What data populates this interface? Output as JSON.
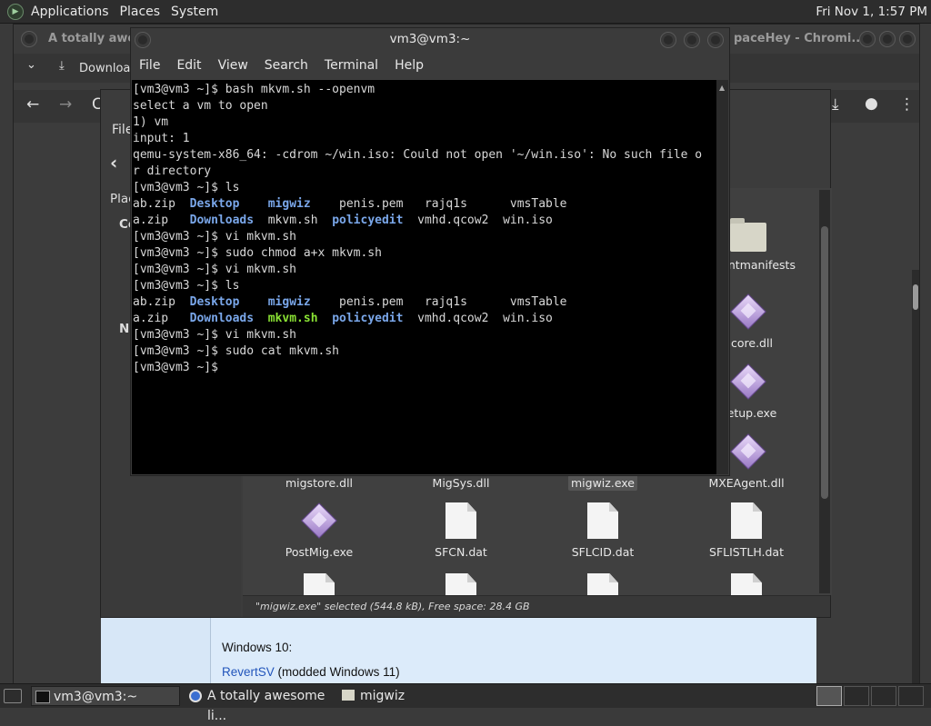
{
  "top_panel": {
    "menus": [
      "Applications",
      "Places",
      "System"
    ],
    "clock": "Fri Nov 1,  1:57 PM"
  },
  "chromium": {
    "title_left": "A totally awesome",
    "title_right": "paceHey - Chromi...",
    "download_label": "Download",
    "web_line1": "Windows 10:",
    "web_link": "RevertSV",
    "web_link_after": " (modded Windows 11)"
  },
  "file_manager": {
    "menu_partial": "File",
    "sidebar_partial": [
      "Plac",
      "Co",
      "N"
    ],
    "row1": [
      {
        "name": "mentmanifests",
        "kind": "folder"
      },
      {
        "name": "gcore.dll",
        "kind": "exe"
      },
      {
        "name": "Setup.exe",
        "kind": "exe"
      },
      {
        "name": "",
        "kind": "exe"
      }
    ],
    "row_labels": [
      "migstore.dll",
      "MigSys.dll",
      "migwiz.exe",
      "MXEAgent.dll"
    ],
    "row2": [
      {
        "name": "PostMig.exe",
        "kind": "exe"
      },
      {
        "name": "SFCN.dat",
        "kind": "doc"
      },
      {
        "name": "SFLCID.dat",
        "kind": "doc"
      },
      {
        "name": "SFLISTLH.dat",
        "kind": "doc"
      }
    ],
    "status": "\"migwiz.exe\" selected (544.8 kB), Free space: 28.4 GB"
  },
  "terminal": {
    "title": "vm3@vm3:~",
    "menus": [
      "File",
      "Edit",
      "View",
      "Search",
      "Terminal",
      "Help"
    ],
    "lines": [
      "[vm3@vm3 ~]$ bash mkvm.sh --openvm",
      "select a vm to open",
      "1) vm",
      "input: 1",
      "qemu-system-x86_64: -cdrom ~/win.iso: Could not open '~/win.iso': No such file o",
      "r directory",
      "[vm3@vm3 ~]$ ls"
    ],
    "ls1": {
      "row1": [
        "ab.zip",
        "Desktop",
        "migwiz",
        "penis.pem",
        "rajq1s",
        "vmsTable"
      ],
      "row2": [
        "a.zip",
        "Downloads",
        "mkvm.sh",
        "policyedit",
        "vmhd.qcow2",
        "win.iso"
      ]
    },
    "lines2": [
      "[vm3@vm3 ~]$ vi mkvm.sh",
      "[vm3@vm3 ~]$ sudo chmod a+x mkvm.sh",
      "[vm3@vm3 ~]$ vi mkvm.sh",
      "[vm3@vm3 ~]$ ls"
    ],
    "lines3": [
      "[vm3@vm3 ~]$ vi mkvm.sh",
      "[vm3@vm3 ~]$ sudo cat mkvm.sh",
      "[vm3@vm3 ~]$ "
    ]
  },
  "taskbar": {
    "items": [
      "vm3@vm3:~",
      "A totally awesome li...",
      "migwiz"
    ]
  }
}
